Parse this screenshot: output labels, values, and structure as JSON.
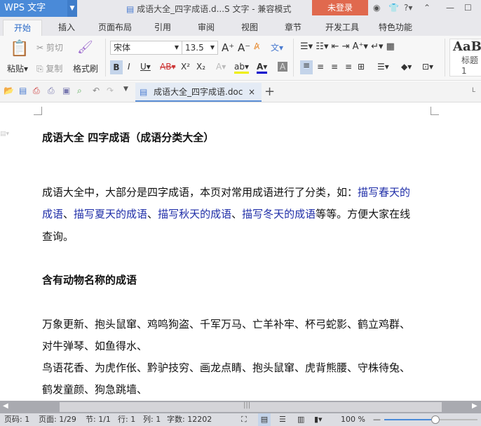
{
  "titlebar": {
    "app": "WPS 文字",
    "doc_title": "成语大全_四字成语.d...S 文字 - 兼容模式",
    "login": "未登录"
  },
  "tabs": [
    "开始",
    "插入",
    "页面布局",
    "引用",
    "审阅",
    "视图",
    "章节",
    "开发工具",
    "特色功能"
  ],
  "ribbon": {
    "paste": "粘贴",
    "cut": "剪切",
    "copy": "复制",
    "format_painter": "格式刷",
    "font": "宋体",
    "font_size": "13.5",
    "style_preview": "AaB",
    "style_label": "标题 1"
  },
  "doc_tab": {
    "name": "成语大全_四字成语.doc"
  },
  "document": {
    "title": "成语大全  四字成语（成语分类大全）",
    "para1_a": "成语大全中，大部分是四字成语，本页对常用成语进行了分类，如：",
    "link_spring": "描写春天的",
    "link_spring2": "成语",
    "sep1": "、",
    "link_summer": "描写夏天的成语",
    "sep2": "、",
    "link_autumn": "描写秋天的成语",
    "sep3": "、",
    "link_winter": "描写冬天的成语",
    "para1_b": "等等。方便大家在线",
    "para1_c": "查询。",
    "heading2": "含有动物名称的成语",
    "lines": [
      "万象更新、抱头鼠窜、鸡鸣狗盗、千军万马、亡羊补牢、杯弓蛇影、鹤立鸡群、",
      "对牛弹琴、如鱼得水、",
      "鸟语花香、为虎作伥、黔驴技穷、画龙点睛、抱头鼠窜、虎背熊腰、守株待兔、",
      "鹤发童颜、狗急跳墙、"
    ]
  },
  "status": {
    "page": "页码: 1",
    "pages": "页面: 1/29",
    "section": "节: 1/1",
    "row": "行: 1",
    "col": "列: 1",
    "words": "字数: 12202",
    "zoom": "100 %"
  },
  "zoom_level": 100
}
